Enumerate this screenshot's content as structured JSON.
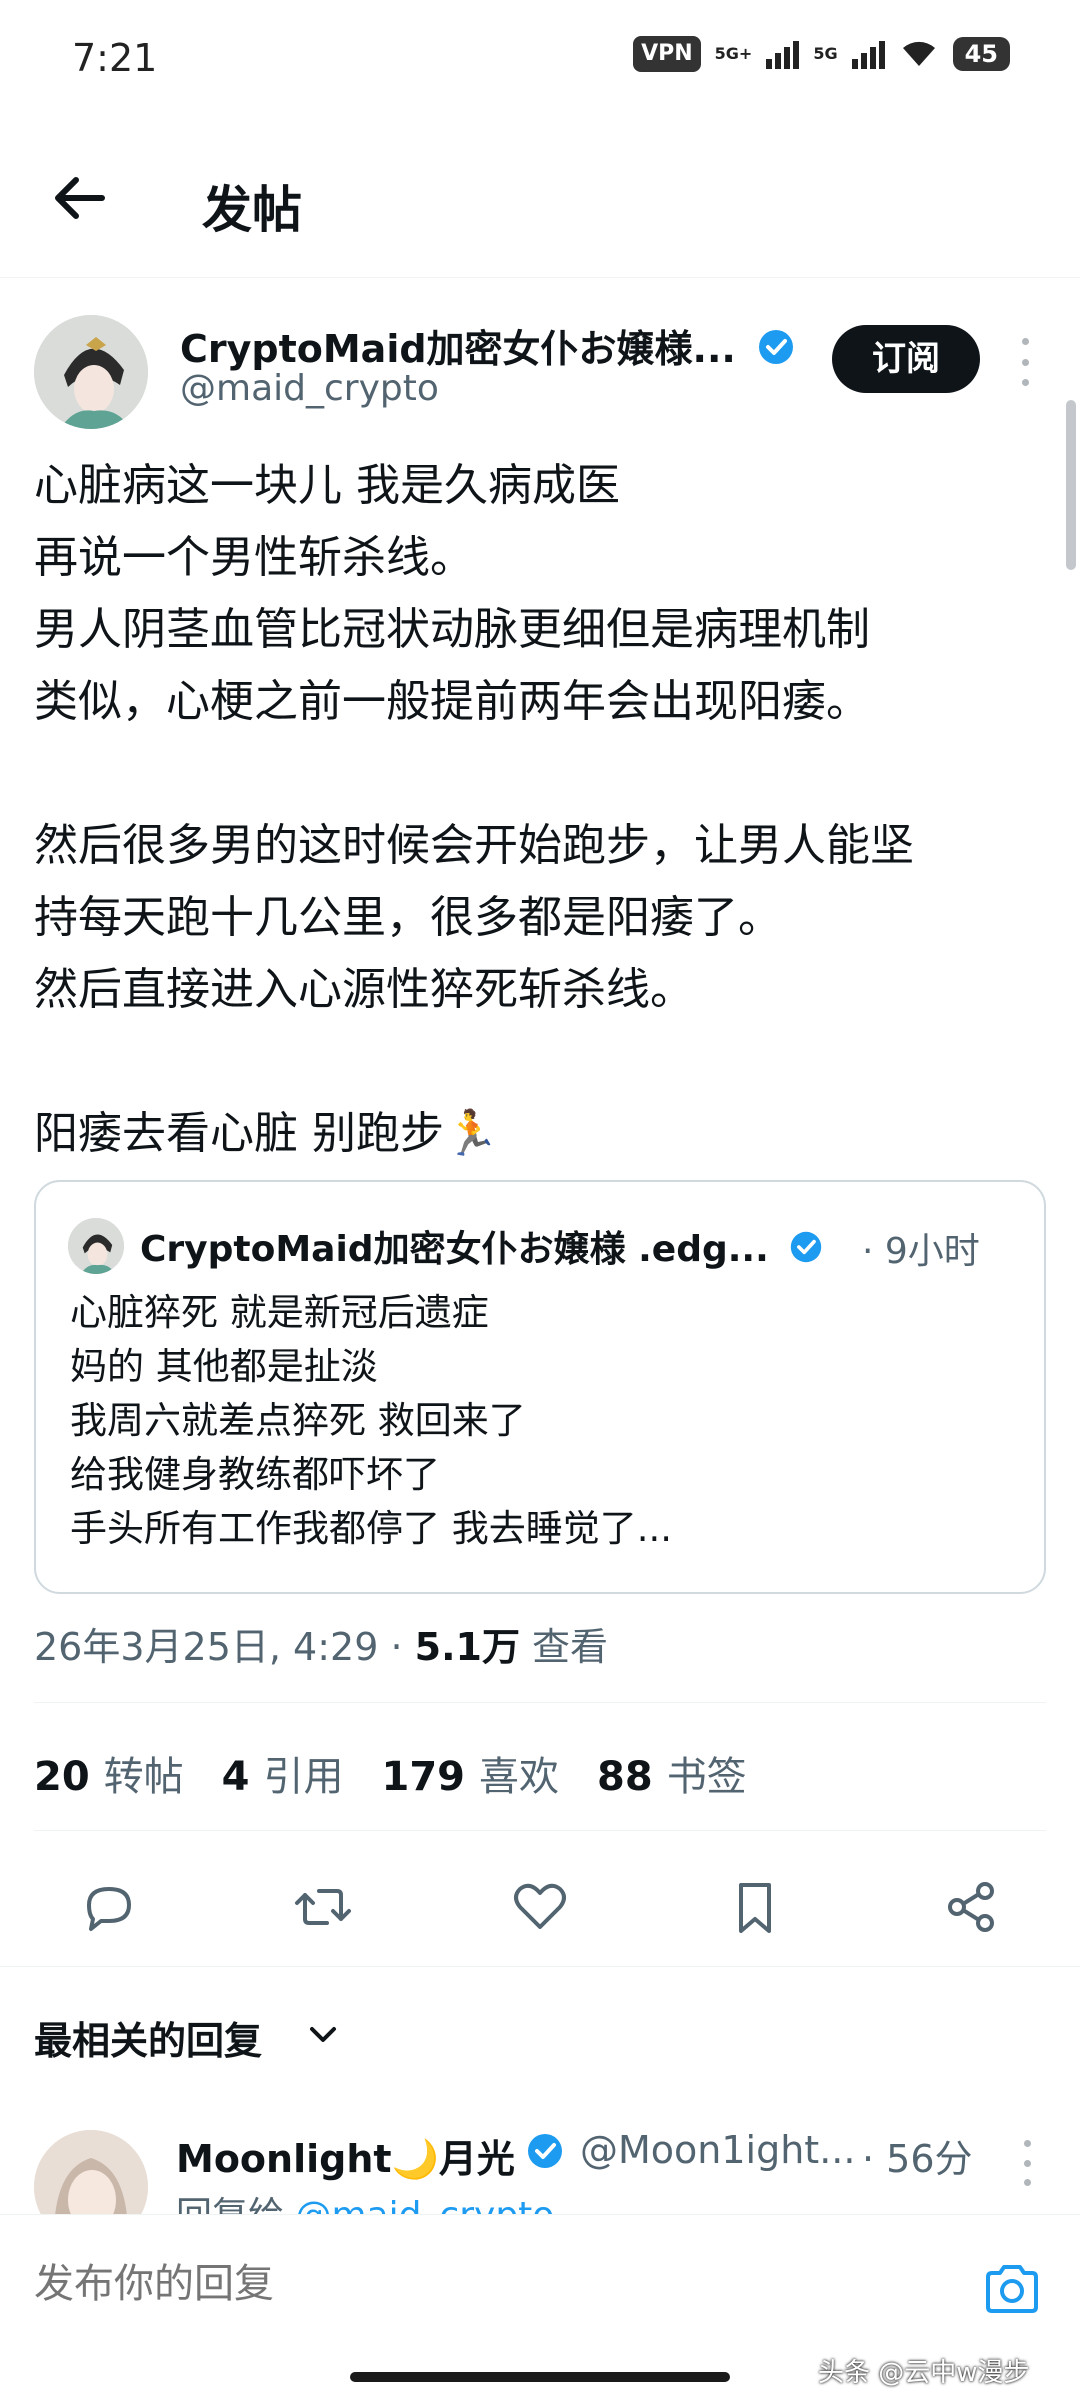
{
  "status_bar": {
    "time": "7:21",
    "vpn": "VPN",
    "net1": "5G+",
    "net2": "5G",
    "battery": "45"
  },
  "header": {
    "title": "发帖"
  },
  "tweet": {
    "author_name": "CryptoMaid加密女仆お嬢様...",
    "author_handle": "@maid_crypto",
    "subscribe_label": "订阅",
    "body_lines": [
      "心脏病这一块儿 我是久病成医",
      "再说一个男性斩杀线。",
      "男人阴茎血管比冠状动脉更细但是病理机制",
      "类似，心梗之前一般提前两年会出现阳痿。",
      "",
      "然后很多男的这时候会开始跑步，让男人能坚",
      "持每天跑十几公里，很多都是阳痿了。",
      "然后直接进入心源性猝死斩杀线。",
      "",
      "阳痿去看心脏 别跑步🏃"
    ],
    "quoted": {
      "author_name": "CryptoMaid加密女仆お嬢様 .edg...",
      "time": "· 9小时",
      "lines": [
        "心脏猝死 就是新冠后遗症",
        "妈的 其他都是扯淡",
        "我周六就差点猝死 救回来了",
        "给我健身教练都吓坏了",
        "手头所有工作我都停了 我去睡觉了..."
      ]
    },
    "date": "26年3月25日, 4:29 · ",
    "views_count": "5.1万",
    "views_label": " 查看",
    "stats": {
      "retweets_count": "20",
      "retweets_label": "转帖",
      "quotes_count": "4",
      "quotes_label": "引用",
      "likes_count": "179",
      "likes_label": "喜欢",
      "bookmarks_count": "88",
      "bookmarks_label": "书签"
    },
    "actions": [
      "reply-icon",
      "retweet-icon",
      "like-icon",
      "bookmark-icon",
      "share-icon"
    ]
  },
  "replies": {
    "section_title": "最相关的回复",
    "first_reply": {
      "name": "Moonlight🌙月光",
      "handle": "@Moon1ight...",
      "time": "· 56分",
      "reply_to_prefix": "回复给 ",
      "reply_to_mention": "@maid_crypto"
    }
  },
  "composer": {
    "placeholder": "发布你的回复"
  },
  "watermark": "头条 @云中w漫步",
  "colors": {
    "accent": "#1d9bf0",
    "text": "#0f1419",
    "secondary": "#536471",
    "border": "#cfd9de"
  }
}
